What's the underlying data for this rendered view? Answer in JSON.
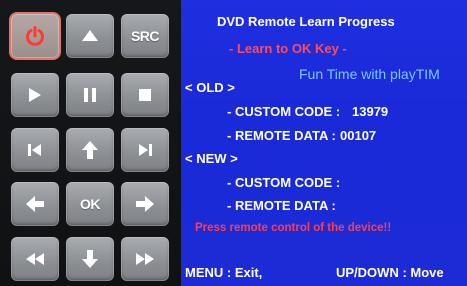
{
  "keypad": {
    "power_icon": "power-icon",
    "src_label": "SRC",
    "ok_label": "OK",
    "accent": "#e8706a",
    "button_color": "#9a9da2"
  },
  "screen": {
    "title": "DVD Remote Learn Progress",
    "subtitle": "- Learn to OK Key -",
    "watermark": "Fun Time with playTIM",
    "old_label": "< OLD >",
    "old_custom_code_label": "- CUSTOM CODE :",
    "old_custom_code_value": "13979",
    "old_remote_data_label": "- REMOTE DATA :",
    "old_remote_data_value": "00107",
    "new_label": "< NEW >",
    "new_custom_code_label": "- CUSTOM CODE :",
    "new_remote_data_label": "- REMOTE DATA :",
    "prompt": "Press remote control of the device!!",
    "footer_left": "MENU : Exit,",
    "footer_right": "UP/DOWN : Move",
    "background": "#1f2fe0",
    "prompt_color": "#ff3d4d",
    "watermark_color": "#7ec7ff"
  }
}
